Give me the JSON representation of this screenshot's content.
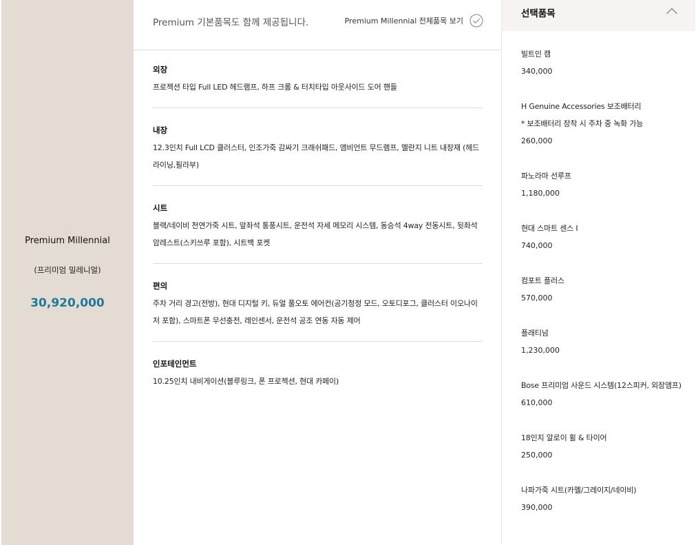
{
  "trim": {
    "name": "Premium Millennial",
    "subname": "(프리미엄 밀레니얼)",
    "price": "30,920,000"
  },
  "header": {
    "note": "Premium 기본품목도 함께 제공됩니다.",
    "view_all_label": "Premium Millennial 전체품목 보기"
  },
  "sections": [
    {
      "title": "외장",
      "desc": "프로젝션 타입 Full LED 헤드램프, 하프 크롬 & 터치타입 아웃사이드 도어 핸들"
    },
    {
      "title": "내장",
      "desc": "12.3인치 Full LCD 클러스터, 인조가죽 감싸기 크래쉬패드, 앰비언트 무드램프, 멜란지 니트 내장재 (헤드라이닝,필라부)"
    },
    {
      "title": "시트",
      "desc": "블랙/네이비 천연가죽 시트, 앞좌석 통풍시트, 운전석 자세 메모리 시스템, 동승석 4way 전동시트, 뒷좌석 암레스트(스키쓰루 포함), 시트백 포켓"
    },
    {
      "title": "편의",
      "desc": "주차 거리 경고(전방), 현대 디지털 키, 듀얼 풀오토 에어컨(공기청정 모드, 오토디포그, 클러스터 이오나이저 포함), 스마트폰 무선충전, 레인센서, 운전석 공조 연동 자동 제어"
    },
    {
      "title": "인포테인먼트",
      "desc": "10.25인치 내비게이션(블루링크, 폰 프로젝션, 현대 카페이)"
    }
  ],
  "options_panel": {
    "title": "선택품목",
    "items": [
      {
        "name": "빌트인 캠",
        "note": "",
        "price": "340,000"
      },
      {
        "name": "H Genuine Accessories 보조배터리",
        "note": "* 보조배터리 장착 시 주차 중 녹화 가능",
        "price": "260,000"
      },
      {
        "name": "파노라마 선루프",
        "note": "",
        "price": "1,180,000"
      },
      {
        "name": "현대 스마트 센스 Ⅰ",
        "note": "",
        "price": "740,000"
      },
      {
        "name": "컴포트 플러스",
        "note": "",
        "price": "570,000"
      },
      {
        "name": "플래티넘",
        "note": "",
        "price": "1,230,000"
      },
      {
        "name": "Bose 프리미엄 사운드 시스템(12스피커, 외장앰프)",
        "note": "",
        "price": "610,000"
      },
      {
        "name": "18인치 알로이 휠 & 타이어",
        "note": "",
        "price": "250,000"
      },
      {
        "name": "나파가죽 시트(카멜/그레이지/네이비)",
        "note": "",
        "price": "390,000"
      }
    ]
  },
  "colors": {
    "trim_bg": "#e4dcd2",
    "price_accent": "#1c7a9c",
    "options_header_bg": "#f6f3f2",
    "divider": "#dcdcdc"
  },
  "icons": {
    "view_all": "check-circle-icon",
    "collapse": "chevron-up-icon"
  }
}
